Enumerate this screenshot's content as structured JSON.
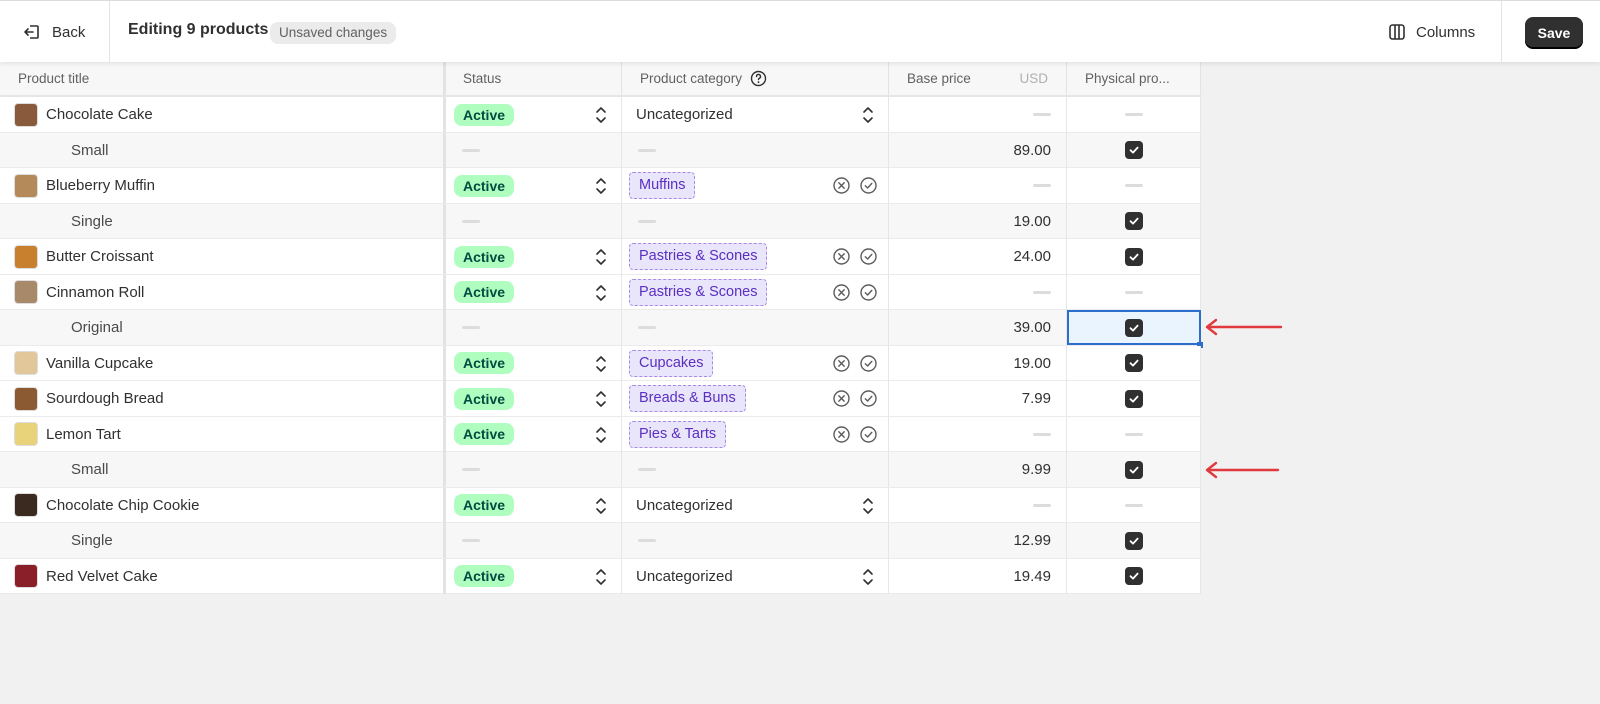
{
  "topbar": {
    "back_label": "Back",
    "title": "Editing 9 products",
    "unsaved_badge": "Unsaved changes",
    "columns_label": "Columns",
    "save_label": "Save"
  },
  "columns": {
    "product_title": "Product title",
    "status": "Status",
    "product_category": "Product category",
    "base_price": "Base price",
    "currency": "USD",
    "physical_product": "Physical pro..."
  },
  "rows": [
    {
      "kind": "product",
      "title": "Chocolate Cake",
      "status": "Active",
      "category_type": "plain",
      "category": "Uncategorized",
      "price": "",
      "physical": null,
      "thumb": "#8a5a3c"
    },
    {
      "kind": "variant",
      "title": "Small",
      "price": "89.00",
      "physical": true
    },
    {
      "kind": "product",
      "title": "Blueberry Muffin",
      "status": "Active",
      "category_type": "tag",
      "category": "Muffins",
      "price": "",
      "physical": null,
      "thumb": "#b58a5a"
    },
    {
      "kind": "variant",
      "title": "Single",
      "price": "19.00",
      "physical": true
    },
    {
      "kind": "product",
      "title": "Butter Croissant",
      "status": "Active",
      "category_type": "tag",
      "category": "Pastries & Scones",
      "price": "24.00",
      "physical": true,
      "thumb": "#c9802e"
    },
    {
      "kind": "product",
      "title": "Cinnamon Roll",
      "status": "Active",
      "category_type": "tag",
      "category": "Pastries & Scones",
      "price": "",
      "physical": null,
      "thumb": "#a88a6a"
    },
    {
      "kind": "variant",
      "title": "Original",
      "price": "39.00",
      "physical": true,
      "selected": true
    },
    {
      "kind": "product",
      "title": "Vanilla Cupcake",
      "status": "Active",
      "category_type": "tag",
      "category": "Cupcakes",
      "price": "19.00",
      "physical": true,
      "thumb": "#e2c79a"
    },
    {
      "kind": "product",
      "title": "Sourdough Bread",
      "status": "Active",
      "category_type": "tag",
      "category": "Breads & Buns",
      "price": "7.99",
      "physical": true,
      "thumb": "#8b5a33"
    },
    {
      "kind": "product",
      "title": "Lemon Tart",
      "status": "Active",
      "category_type": "tag",
      "category": "Pies & Tarts",
      "price": "",
      "physical": null,
      "thumb": "#e8d27a"
    },
    {
      "kind": "variant",
      "title": "Small",
      "price": "9.99",
      "physical": true
    },
    {
      "kind": "product",
      "title": "Chocolate Chip Cookie",
      "status": "Active",
      "category_type": "plain",
      "category": "Uncategorized",
      "price": "",
      "physical": null,
      "thumb": "#3b2a20"
    },
    {
      "kind": "variant",
      "title": "Single",
      "price": "12.99",
      "physical": true
    },
    {
      "kind": "product",
      "title": "Red Velvet Cake",
      "status": "Active",
      "category_type": "plain",
      "category": "Uncategorized",
      "price": "19.49",
      "physical": true,
      "thumb": "#8a1f2a"
    }
  ],
  "colors": {
    "active_badge_bg": "#affebf",
    "tag_bg": "#e9e5fa",
    "tag_text": "#5a2fc2",
    "selection": "#2c6ecb",
    "annotation_arrow": "#e0393e"
  },
  "icons": [
    "back-icon",
    "columns-icon",
    "help-icon",
    "stepper-icon",
    "remove-icon",
    "confirm-icon",
    "checkbox-checked-icon",
    "arrow-annotation"
  ]
}
